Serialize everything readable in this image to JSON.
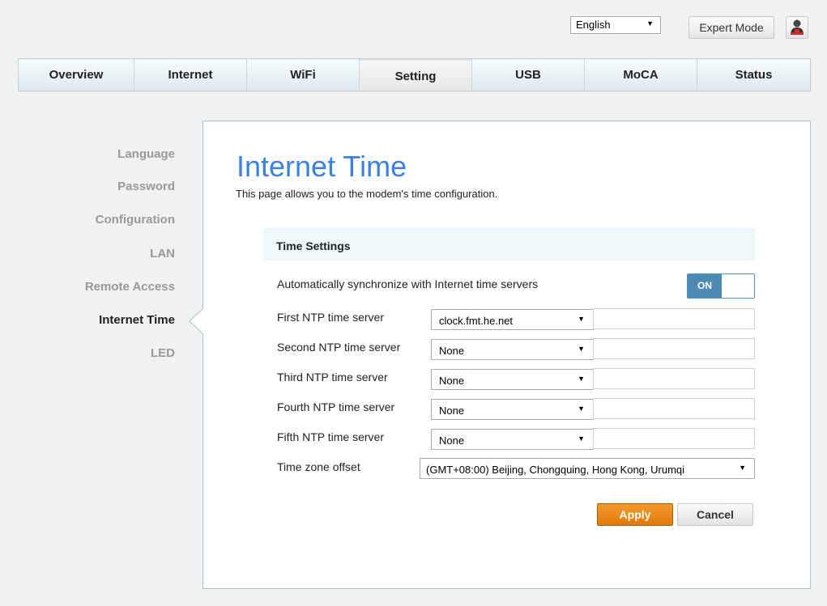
{
  "header": {
    "language": "English",
    "expert_mode": "Expert Mode"
  },
  "nav": {
    "items": [
      "Overview",
      "Internet",
      "WiFi",
      "Setting",
      "USB",
      "MoCA",
      "Status"
    ],
    "active": "Setting"
  },
  "sidebar": {
    "items": [
      "Language",
      "Password",
      "Configuration",
      "LAN",
      "Remote Access",
      "Internet Time",
      "LED"
    ],
    "active": "Internet Time"
  },
  "page": {
    "title": "Internet Time",
    "description": "This page allows you to the modem's time configuration."
  },
  "time_settings": {
    "heading": "Time Settings",
    "auto_sync_label": "Automatically synchronize with Internet time servers",
    "auto_sync_state": "ON",
    "servers": [
      {
        "label": "First NTP time server",
        "value": "clock.fmt.he.net"
      },
      {
        "label": "Second NTP time server",
        "value": "None"
      },
      {
        "label": "Third NTP time server",
        "value": "None"
      },
      {
        "label": "Fourth NTP time server",
        "value": "None"
      },
      {
        "label": "Fifth NTP time server",
        "value": "None"
      }
    ],
    "timezone_label": "Time zone offset",
    "timezone_value": "(GMT+08:00) Beijing, Chongquing, Hong Kong, Urumqi"
  },
  "actions": {
    "apply": "Apply",
    "cancel": "Cancel"
  },
  "colors": {
    "title_blue": "#3b82e0",
    "toggle_on": "#4e89b4",
    "apply_orange": "#e98a14",
    "panel_border": "#9ec8d8"
  }
}
